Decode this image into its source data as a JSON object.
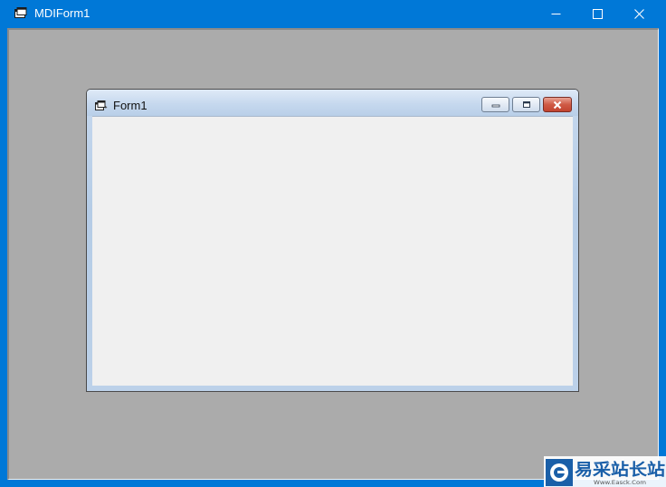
{
  "mdi_window": {
    "title": "MDIForm1",
    "app_icon": "vb-form-icon",
    "controls": {
      "minimize_icon": "minimize-icon",
      "maximize_icon": "maximize-icon",
      "close_icon": "close-icon"
    }
  },
  "child_window": {
    "title": "Form1",
    "app_icon": "vb-form-icon",
    "controls": {
      "minimize_icon": "minimize-icon",
      "maximize_icon": "restore-icon",
      "close_icon": "close-icon"
    }
  },
  "watermark": {
    "brand_text": "易采站长站",
    "sub_text": "Www.Easck.Com"
  },
  "colors": {
    "titlebar_active": "#0078d7",
    "mdi_background": "#ababab",
    "form_background": "#f0f0f0",
    "child_close_red": "#c24330"
  }
}
